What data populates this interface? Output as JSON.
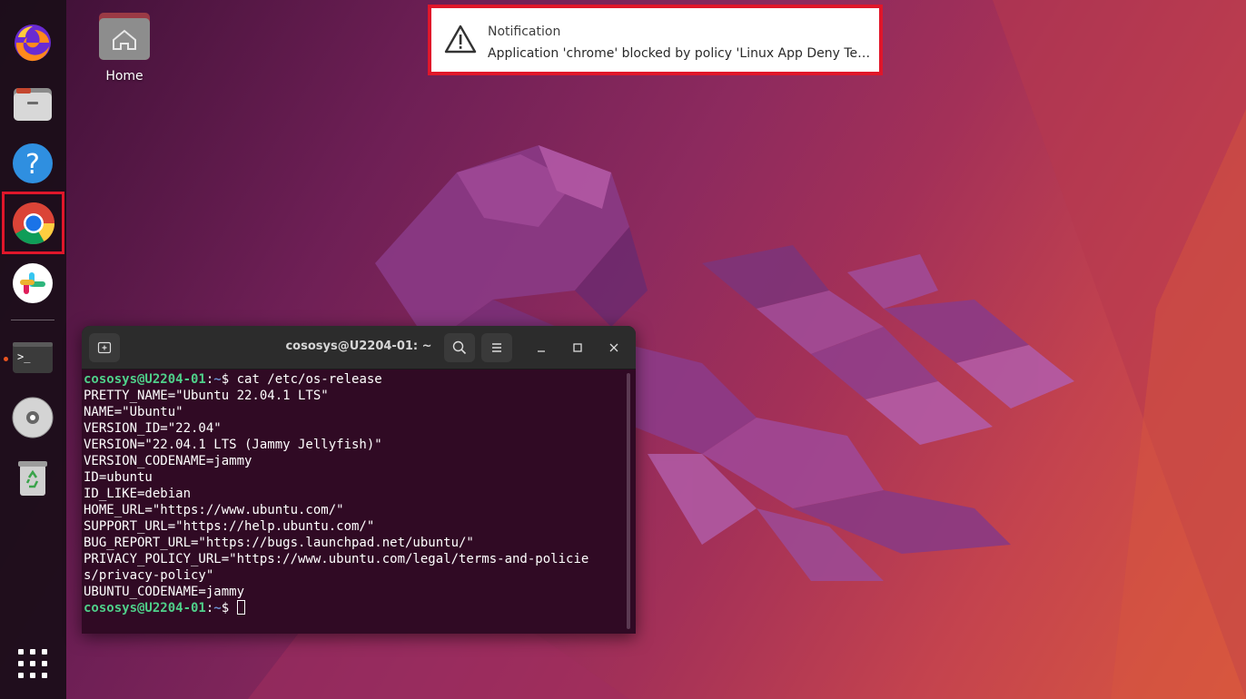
{
  "desktop": {
    "home_label": "Home"
  },
  "dock": {
    "items": [
      {
        "name": "Firefox",
        "icon": "firefox-icon"
      },
      {
        "name": "Files",
        "icon": "files-icon"
      },
      {
        "name": "Help",
        "icon": "help-icon"
      },
      {
        "name": "Google Chrome",
        "icon": "chrome-icon",
        "highlighted": true
      },
      {
        "name": "Slack",
        "icon": "slack-icon"
      },
      {
        "name": "Terminal",
        "icon": "terminal-icon",
        "running": true
      },
      {
        "name": "Disc",
        "icon": "disc-icon"
      },
      {
        "name": "Trash",
        "icon": "trash-icon"
      },
      {
        "name": "Show Applications",
        "icon": "app-grid-icon"
      }
    ],
    "help_glyph": "?",
    "terminal_glyph": ">_"
  },
  "notification": {
    "title": "Notification",
    "body": "Application 'chrome' blocked by policy 'Linux App Deny Test #…",
    "highlight_color": "#e0162a"
  },
  "terminal": {
    "title": "cososys@U2204-01: ~",
    "prompt_user": "cososys@U2204-01",
    "prompt_sep": ":",
    "prompt_path": "~",
    "prompt_dollar": "$ ",
    "command": "cat /etc/os-release",
    "output": [
      "PRETTY_NAME=\"Ubuntu 22.04.1 LTS\"",
      "NAME=\"Ubuntu\"",
      "VERSION_ID=\"22.04\"",
      "VERSION=\"22.04.1 LTS (Jammy Jellyfish)\"",
      "VERSION_CODENAME=jammy",
      "ID=ubuntu",
      "ID_LIKE=debian",
      "HOME_URL=\"https://www.ubuntu.com/\"",
      "SUPPORT_URL=\"https://help.ubuntu.com/\"",
      "BUG_REPORT_URL=\"https://bugs.launchpad.net/ubuntu/\"",
      "PRIVACY_POLICY_URL=\"https://www.ubuntu.com/legal/terms-and-policie",
      "s/privacy-policy\"",
      "UBUNTU_CODENAME=jammy"
    ],
    "colors": {
      "background": "#300a24",
      "prompt_user": "#4fd08a",
      "prompt_path": "#6b8fd0"
    }
  }
}
